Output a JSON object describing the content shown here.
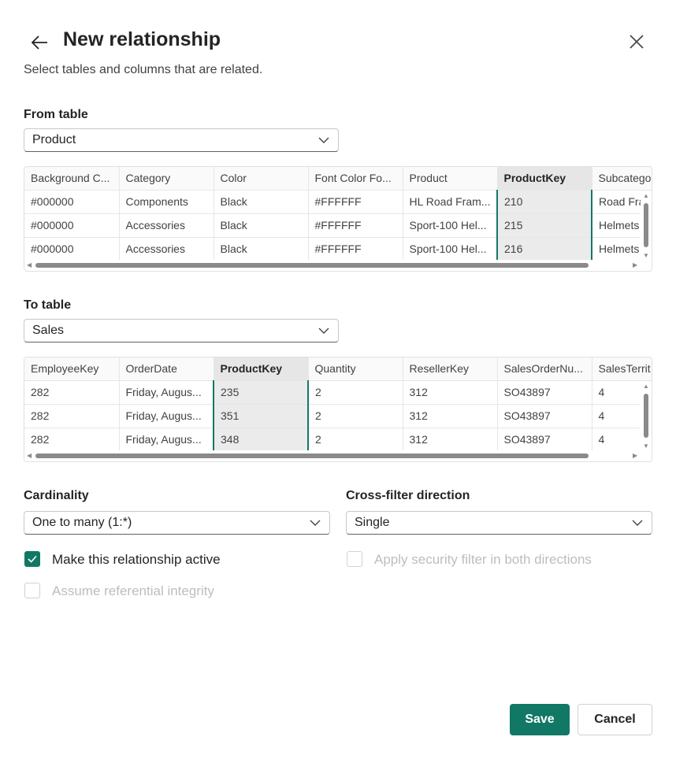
{
  "header": {
    "title": "New relationship",
    "subtitle": "Select tables and columns that are related."
  },
  "from": {
    "label": "From table",
    "selected": "Product",
    "columns": [
      "Background C...",
      "Category",
      "Color",
      "Font Color Fo...",
      "Product",
      "ProductKey",
      "Subcatego"
    ],
    "selected_column": 5,
    "rows": [
      [
        "#000000",
        "Components",
        "Black",
        "#FFFFFF",
        "HL Road Fram...",
        "210",
        "Road Fra"
      ],
      [
        "#000000",
        "Accessories",
        "Black",
        "#FFFFFF",
        "Sport-100 Hel...",
        "215",
        "Helmets"
      ],
      [
        "#000000",
        "Accessories",
        "Black",
        "#FFFFFF",
        "Sport-100 Hel...",
        "216",
        "Helmets"
      ]
    ]
  },
  "to": {
    "label": "To table",
    "selected": "Sales",
    "columns": [
      "EmployeeKey",
      "OrderDate",
      "ProductKey",
      "Quantity",
      "ResellerKey",
      "SalesOrderNu...",
      "SalesTerrit"
    ],
    "selected_column": 2,
    "rows": [
      [
        "282",
        "Friday, Augus...",
        "235",
        "2",
        "312",
        "SO43897",
        "4"
      ],
      [
        "282",
        "Friday, Augus...",
        "351",
        "2",
        "312",
        "SO43897",
        "4"
      ],
      [
        "282",
        "Friday, Augus...",
        "348",
        "2",
        "312",
        "SO43897",
        "4"
      ]
    ]
  },
  "cardinality": {
    "label": "Cardinality",
    "selected": "One to many (1:*)"
  },
  "crossfilter": {
    "label": "Cross-filter direction",
    "selected": "Single"
  },
  "options": {
    "active": {
      "label": "Make this relationship active",
      "checked": true,
      "enabled": true
    },
    "security": {
      "label": "Apply security filter in both directions",
      "checked": false,
      "enabled": false
    },
    "integrity": {
      "label": "Assume referential integrity",
      "checked": false,
      "enabled": false
    }
  },
  "buttons": {
    "save": "Save",
    "cancel": "Cancel"
  },
  "colors": {
    "accent": "#117865"
  }
}
